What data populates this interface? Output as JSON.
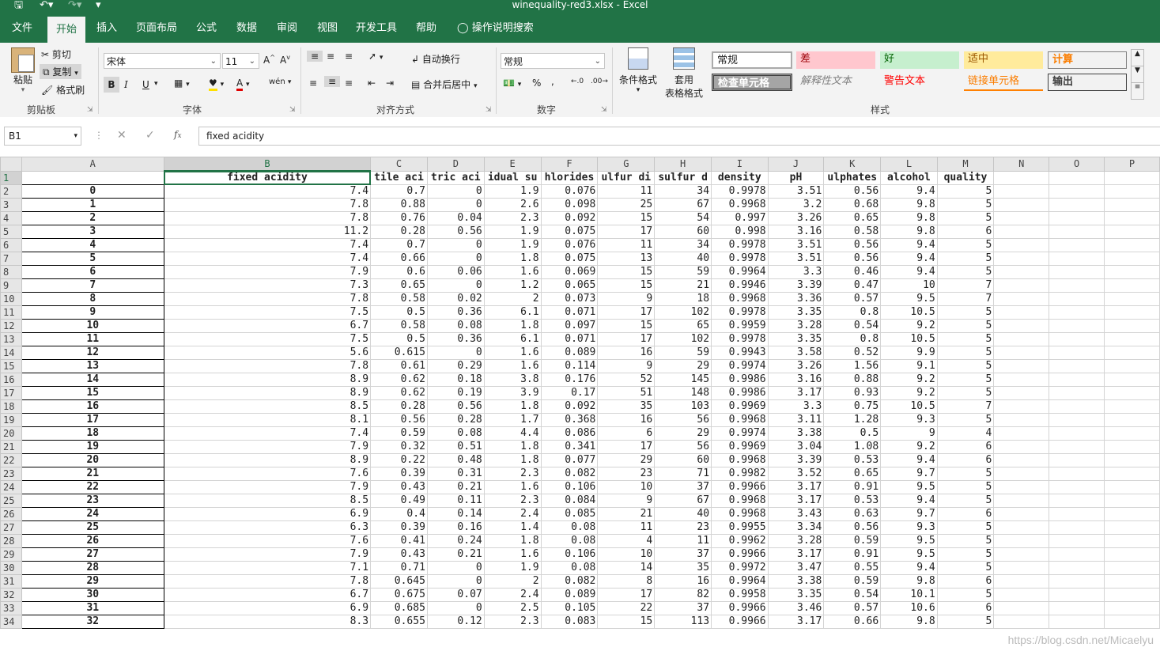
{
  "window": {
    "title": "winequality-red3.xlsx  -  Excel",
    "qa_save_icon": "save-icon",
    "qa_undo_icon": "undo-icon",
    "qa_redo_icon": "redo-icon",
    "qa_customize_icon": "customize-icon"
  },
  "tabs": [
    "文件",
    "开始",
    "插入",
    "页面布局",
    "公式",
    "数据",
    "审阅",
    "视图",
    "开发工具",
    "帮助"
  ],
  "tell_me": "操作说明搜索",
  "ribbon": {
    "clipboard": {
      "paste": "粘贴",
      "cut": "剪切",
      "copy": "复制",
      "format_painter": "格式刷",
      "label": "剪贴板"
    },
    "font": {
      "name": "宋体",
      "size": "11",
      "label": "字体",
      "bold": "B",
      "italic": "I",
      "underline": "U"
    },
    "alignment": {
      "wrap": "自动换行",
      "merge": "合并后居中",
      "label": "对齐方式"
    },
    "number": {
      "format": "常规",
      "percent": "%",
      "comma": ",",
      "label": "数字"
    },
    "styles": {
      "conditional": "条件格式",
      "table_line1": "套用",
      "table_line2": "表格格式",
      "label": "样式",
      "cells": [
        "常规",
        "差",
        "好",
        "适中",
        "计算",
        "检查单元格",
        "解释性文本",
        "警告文本",
        "链接单元格",
        "输出"
      ]
    }
  },
  "formula_bar": {
    "name_box": "B1",
    "formula": "fixed acidity"
  },
  "columns": [
    "A",
    "B",
    "C",
    "D",
    "E",
    "F",
    "G",
    "H",
    "I",
    "J",
    "K",
    "L",
    "M",
    "N",
    "O",
    "P"
  ],
  "headers": [
    "fixed acidity",
    "tile aci",
    "tric aci",
    "idual su",
    "hlorides",
    "ulfur di",
    "sulfur d",
    "density",
    "pH",
    "ulphates",
    "alcohol",
    "quality"
  ],
  "rows": [
    [
      "0",
      "7.4",
      "0.7",
      "0",
      "1.9",
      "0.076",
      "11",
      "34",
      "0.9978",
      "3.51",
      "0.56",
      "9.4",
      "5"
    ],
    [
      "1",
      "7.8",
      "0.88",
      "0",
      "2.6",
      "0.098",
      "25",
      "67",
      "0.9968",
      "3.2",
      "0.68",
      "9.8",
      "5"
    ],
    [
      "2",
      "7.8",
      "0.76",
      "0.04",
      "2.3",
      "0.092",
      "15",
      "54",
      "0.997",
      "3.26",
      "0.65",
      "9.8",
      "5"
    ],
    [
      "3",
      "11.2",
      "0.28",
      "0.56",
      "1.9",
      "0.075",
      "17",
      "60",
      "0.998",
      "3.16",
      "0.58",
      "9.8",
      "6"
    ],
    [
      "4",
      "7.4",
      "0.7",
      "0",
      "1.9",
      "0.076",
      "11",
      "34",
      "0.9978",
      "3.51",
      "0.56",
      "9.4",
      "5"
    ],
    [
      "5",
      "7.4",
      "0.66",
      "0",
      "1.8",
      "0.075",
      "13",
      "40",
      "0.9978",
      "3.51",
      "0.56",
      "9.4",
      "5"
    ],
    [
      "6",
      "7.9",
      "0.6",
      "0.06",
      "1.6",
      "0.069",
      "15",
      "59",
      "0.9964",
      "3.3",
      "0.46",
      "9.4",
      "5"
    ],
    [
      "7",
      "7.3",
      "0.65",
      "0",
      "1.2",
      "0.065",
      "15",
      "21",
      "0.9946",
      "3.39",
      "0.47",
      "10",
      "7"
    ],
    [
      "8",
      "7.8",
      "0.58",
      "0.02",
      "2",
      "0.073",
      "9",
      "18",
      "0.9968",
      "3.36",
      "0.57",
      "9.5",
      "7"
    ],
    [
      "9",
      "7.5",
      "0.5",
      "0.36",
      "6.1",
      "0.071",
      "17",
      "102",
      "0.9978",
      "3.35",
      "0.8",
      "10.5",
      "5"
    ],
    [
      "10",
      "6.7",
      "0.58",
      "0.08",
      "1.8",
      "0.097",
      "15",
      "65",
      "0.9959",
      "3.28",
      "0.54",
      "9.2",
      "5"
    ],
    [
      "11",
      "7.5",
      "0.5",
      "0.36",
      "6.1",
      "0.071",
      "17",
      "102",
      "0.9978",
      "3.35",
      "0.8",
      "10.5",
      "5"
    ],
    [
      "12",
      "5.6",
      "0.615",
      "0",
      "1.6",
      "0.089",
      "16",
      "59",
      "0.9943",
      "3.58",
      "0.52",
      "9.9",
      "5"
    ],
    [
      "13",
      "7.8",
      "0.61",
      "0.29",
      "1.6",
      "0.114",
      "9",
      "29",
      "0.9974",
      "3.26",
      "1.56",
      "9.1",
      "5"
    ],
    [
      "14",
      "8.9",
      "0.62",
      "0.18",
      "3.8",
      "0.176",
      "52",
      "145",
      "0.9986",
      "3.16",
      "0.88",
      "9.2",
      "5"
    ],
    [
      "15",
      "8.9",
      "0.62",
      "0.19",
      "3.9",
      "0.17",
      "51",
      "148",
      "0.9986",
      "3.17",
      "0.93",
      "9.2",
      "5"
    ],
    [
      "16",
      "8.5",
      "0.28",
      "0.56",
      "1.8",
      "0.092",
      "35",
      "103",
      "0.9969",
      "3.3",
      "0.75",
      "10.5",
      "7"
    ],
    [
      "17",
      "8.1",
      "0.56",
      "0.28",
      "1.7",
      "0.368",
      "16",
      "56",
      "0.9968",
      "3.11",
      "1.28",
      "9.3",
      "5"
    ],
    [
      "18",
      "7.4",
      "0.59",
      "0.08",
      "4.4",
      "0.086",
      "6",
      "29",
      "0.9974",
      "3.38",
      "0.5",
      "9",
      "4"
    ],
    [
      "19",
      "7.9",
      "0.32",
      "0.51",
      "1.8",
      "0.341",
      "17",
      "56",
      "0.9969",
      "3.04",
      "1.08",
      "9.2",
      "6"
    ],
    [
      "20",
      "8.9",
      "0.22",
      "0.48",
      "1.8",
      "0.077",
      "29",
      "60",
      "0.9968",
      "3.39",
      "0.53",
      "9.4",
      "6"
    ],
    [
      "21",
      "7.6",
      "0.39",
      "0.31",
      "2.3",
      "0.082",
      "23",
      "71",
      "0.9982",
      "3.52",
      "0.65",
      "9.7",
      "5"
    ],
    [
      "22",
      "7.9",
      "0.43",
      "0.21",
      "1.6",
      "0.106",
      "10",
      "37",
      "0.9966",
      "3.17",
      "0.91",
      "9.5",
      "5"
    ],
    [
      "23",
      "8.5",
      "0.49",
      "0.11",
      "2.3",
      "0.084",
      "9",
      "67",
      "0.9968",
      "3.17",
      "0.53",
      "9.4",
      "5"
    ],
    [
      "24",
      "6.9",
      "0.4",
      "0.14",
      "2.4",
      "0.085",
      "21",
      "40",
      "0.9968",
      "3.43",
      "0.63",
      "9.7",
      "6"
    ],
    [
      "25",
      "6.3",
      "0.39",
      "0.16",
      "1.4",
      "0.08",
      "11",
      "23",
      "0.9955",
      "3.34",
      "0.56",
      "9.3",
      "5"
    ],
    [
      "26",
      "7.6",
      "0.41",
      "0.24",
      "1.8",
      "0.08",
      "4",
      "11",
      "0.9962",
      "3.28",
      "0.59",
      "9.5",
      "5"
    ],
    [
      "27",
      "7.9",
      "0.43",
      "0.21",
      "1.6",
      "0.106",
      "10",
      "37",
      "0.9966",
      "3.17",
      "0.91",
      "9.5",
      "5"
    ],
    [
      "28",
      "7.1",
      "0.71",
      "0",
      "1.9",
      "0.08",
      "14",
      "35",
      "0.9972",
      "3.47",
      "0.55",
      "9.4",
      "5"
    ],
    [
      "29",
      "7.8",
      "0.645",
      "0",
      "2",
      "0.082",
      "8",
      "16",
      "0.9964",
      "3.38",
      "0.59",
      "9.8",
      "6"
    ],
    [
      "30",
      "6.7",
      "0.675",
      "0.07",
      "2.4",
      "0.089",
      "17",
      "82",
      "0.9958",
      "3.35",
      "0.54",
      "10.1",
      "5"
    ],
    [
      "31",
      "6.9",
      "0.685",
      "0",
      "2.5",
      "0.105",
      "22",
      "37",
      "0.9966",
      "3.46",
      "0.57",
      "10.6",
      "6"
    ],
    [
      "32",
      "8.3",
      "0.655",
      "0.12",
      "2.3",
      "0.083",
      "15",
      "113",
      "0.9966",
      "3.17",
      "0.66",
      "9.8",
      "5"
    ]
  ],
  "watermark": "https://blog.csdn.net/Micaelyu",
  "colors": {
    "excel_green": "#217346",
    "ribbon_bg": "#f3f3f3"
  }
}
